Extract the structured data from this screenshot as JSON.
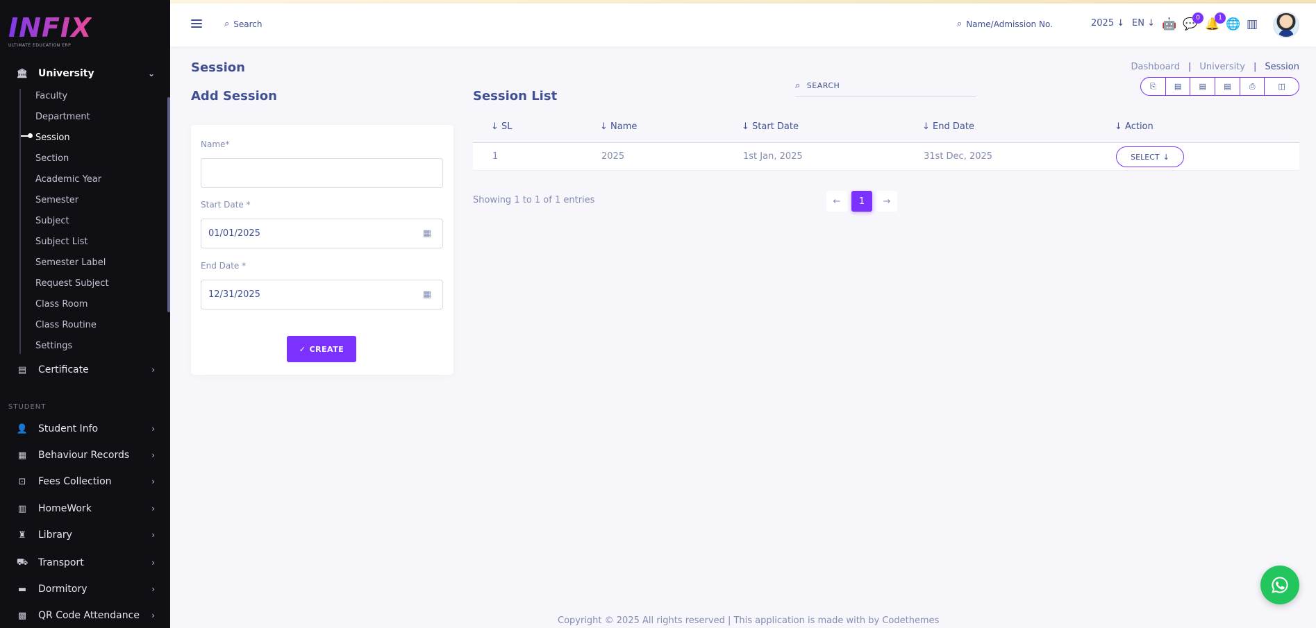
{
  "brand": {
    "name": "INFIX",
    "tagline": "ULTIMATE EDUCATION ERP"
  },
  "sidebar": {
    "university": {
      "label": "University",
      "expanded": true
    },
    "sub_items": [
      {
        "label": "Faculty"
      },
      {
        "label": "Department"
      },
      {
        "label": "Session"
      },
      {
        "label": "Section"
      },
      {
        "label": "Academic Year"
      },
      {
        "label": "Semester"
      },
      {
        "label": "Subject"
      },
      {
        "label": "Subject List"
      },
      {
        "label": "Semester Label"
      },
      {
        "label": "Request Subject"
      },
      {
        "label": "Class Room"
      },
      {
        "label": "Class Routine"
      },
      {
        "label": "Settings"
      }
    ],
    "current_sub_item": "Session",
    "certificate": "Certificate",
    "section_student": "STUDENT",
    "modules": [
      {
        "label": "Student Info",
        "icon": "student-icon"
      },
      {
        "label": "Behaviour Records",
        "icon": "records-icon"
      },
      {
        "label": "Fees Collection",
        "icon": "fees-icon"
      },
      {
        "label": "HomeWork",
        "icon": "book-icon"
      },
      {
        "label": "Library",
        "icon": "library-icon"
      },
      {
        "label": "Transport",
        "icon": "bus-icon"
      },
      {
        "label": "Dormitory",
        "icon": "bed-icon"
      },
      {
        "label": "QR Code Attendance",
        "icon": "qr-icon"
      }
    ]
  },
  "topbar": {
    "search_label": "Search",
    "admission_search": "Name/Admission No.",
    "year": "2025",
    "language": "EN",
    "messages_count": "0",
    "notifications_count": "1"
  },
  "page": {
    "title": "Session",
    "breadcrumb": [
      "Dashboard",
      "University",
      "Session"
    ]
  },
  "form": {
    "heading": "Add Session",
    "name_label": "Name*",
    "name_value": "",
    "start_label": "Start Date *",
    "start_value": "01/01/2025",
    "end_label": "End Date *",
    "end_value": "12/31/2025",
    "create_label": "CREATE"
  },
  "list": {
    "heading": "Session List",
    "search_placeholder": "SEARCH",
    "columns": [
      "SL",
      "Name",
      "Start Date",
      "End Date",
      "Action"
    ],
    "rows": [
      {
        "sl": "1",
        "name": "2025",
        "start": "1st Jan, 2025",
        "end": "31st Dec, 2025",
        "action": "SELECT"
      }
    ],
    "showing": "Showing 1 to 1 of 1 entries",
    "current_page": "1"
  },
  "footer": {
    "text": "Copyright © 2025 All rights reserved | This application is made with by Codethemes"
  },
  "colors": {
    "accent": "#7c32ff",
    "sidebar_bg": "#0f0f14",
    "text": "#415094",
    "muted": "#828bb2",
    "whatsapp": "#22c55e"
  }
}
